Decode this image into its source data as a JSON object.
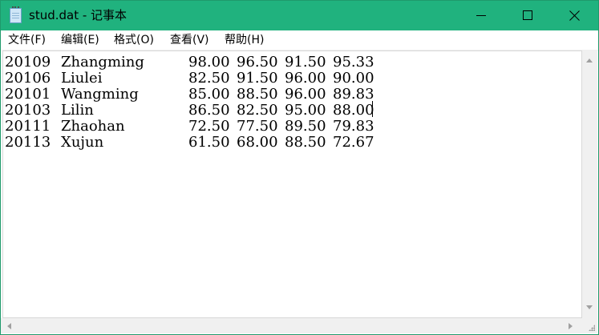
{
  "window": {
    "title": "stud.dat - 记事本",
    "icon": "notepad-icon",
    "controls": [
      "minimize-icon",
      "maximize-icon",
      "close-icon"
    ],
    "accent_color": "#20b27e"
  },
  "menu": {
    "items": [
      "文件(F)",
      "编辑(E)",
      "格式(O)",
      "查看(V)",
      "帮助(H)"
    ]
  },
  "document": {
    "rows": [
      {
        "id": "20109",
        "name": "Zhangming",
        "scores": [
          "98.00",
          "96.50",
          "91.50",
          "95.33"
        ]
      },
      {
        "id": "20106",
        "name": "Liulei",
        "scores": [
          "82.50",
          "91.50",
          "96.00",
          "90.00"
        ]
      },
      {
        "id": "20101",
        "name": "Wangming",
        "scores": [
          "85.00",
          "88.50",
          "96.00",
          "89.83"
        ]
      },
      {
        "id": "20103",
        "name": "Lilin",
        "scores": [
          "86.50",
          "82.50",
          "95.00",
          "88.00"
        ]
      },
      {
        "id": "20111",
        "name": "Zhaohan",
        "scores": [
          "72.50",
          "77.50",
          "89.50",
          "79.83"
        ]
      },
      {
        "id": "20113",
        "name": "Xujun",
        "scores": [
          "61.50",
          "68.00",
          "88.50",
          "72.67"
        ]
      }
    ]
  }
}
